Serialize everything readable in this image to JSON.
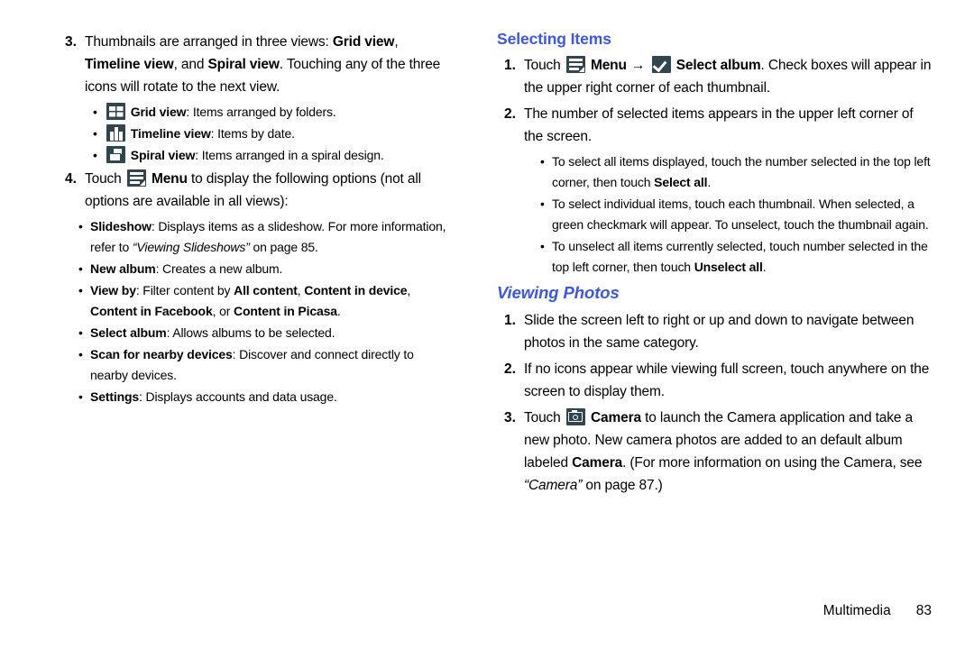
{
  "left_column": {
    "step3": {
      "number": "3.",
      "text_a": "Thumbnails are arranged in three views: ",
      "bold_a": "Grid view",
      "text_b": ", ",
      "bold_b": "Timeline view",
      "text_c": ", and ",
      "bold_c": "Spiral view",
      "text_d": ". Touching any of the three icons will rotate to the next view."
    },
    "view_bullets": [
      {
        "icon": "grid-view-icon",
        "label": "Grid view",
        "desc": ": Items arranged by folders."
      },
      {
        "icon": "timeline-view-icon",
        "label": "Timeline view",
        "desc": ": Items by date."
      },
      {
        "icon": "spiral-view-icon",
        "label": "Spiral view",
        "desc": ": Items arranged in a spiral design."
      }
    ],
    "step4": {
      "number": "4.",
      "text_a": "Touch ",
      "icon": "menu-icon",
      "bold_a": "Menu",
      "text_b": " to display the following options (not all options are available in all views):"
    },
    "menu_options": [
      {
        "label": "Slideshow",
        "desc_a": ": Displays items as a slideshow. For more information, refer to ",
        "italic": "“Viewing Slideshows”",
        "desc_b": " on page 85."
      },
      {
        "label": "New album",
        "desc_a": ": Creates a new album.",
        "italic": "",
        "desc_b": ""
      },
      {
        "label": "View by",
        "desc_a": ": Filter content by ",
        "bold_list": [
          "All content",
          "Content in device",
          "Content in Facebook",
          "Content in Picasa"
        ],
        "sep_1": ", ",
        "sep_2": ", ",
        "sep_3": ", or ",
        "desc_b": "."
      },
      {
        "label": "Select album",
        "desc_a": ": Allows albums to be selected.",
        "italic": "",
        "desc_b": ""
      },
      {
        "label": "Scan for nearby devices",
        "desc_a": ": Discover and connect directly to nearby devices.",
        "italic": "",
        "desc_b": ""
      },
      {
        "label": "Settings",
        "desc_a": ": Displays accounts and data usage.",
        "italic": "",
        "desc_b": ""
      }
    ]
  },
  "right_column": {
    "heading_selecting": "Selecting Items",
    "step1": {
      "number": "1.",
      "text_a": "Touch ",
      "menu_icon": "menu-icon",
      "bold_menu": "Menu",
      "arrow": "→",
      "check_icon": "check-icon",
      "bold_select": "Select album",
      "text_b": ". Check boxes will appear in the upper right corner of each thumbnail."
    },
    "step2": {
      "number": "2.",
      "text": "The number of selected items appears in the upper left corner of the screen."
    },
    "select_bullets": [
      {
        "text_a": "To select all items displayed, touch the number selected in the top left corner, then touch ",
        "bold": "Select all",
        "text_b": "."
      },
      {
        "text_a": "To select individual items, touch each thumbnail. When selected, a green checkmark will appear. To unselect, touch the thumbnail again.",
        "bold": "",
        "text_b": ""
      },
      {
        "text_a": "To unselect all items currently selected, touch number selected in the top left corner, then touch ",
        "bold": "Unselect all",
        "text_b": "."
      }
    ],
    "heading_viewing": "Viewing Photos",
    "view_step1": {
      "number": "1.",
      "text": "Slide the screen left to right or up and down to navigate between photos in the same category."
    },
    "view_step2": {
      "number": "2.",
      "text": "If no icons appear while viewing full screen, touch anywhere on the screen to display them."
    },
    "view_step3": {
      "number": "3.",
      "text_a": "Touch ",
      "icon": "camera-icon",
      "bold_a": "Camera",
      "text_b": " to launch the Camera application and take a new photo. New camera photos are added to an default album labeled ",
      "bold_b": "Camera",
      "text_c": ". (For more information on using the Camera, see ",
      "italic": "“Camera”",
      "text_d": " on page 87.)"
    }
  },
  "footer": {
    "section": "Multimedia",
    "page": "83"
  },
  "colors": {
    "heading_blue": "#3b57e8",
    "icon_slate": "#2f4550",
    "text_black": "#000000"
  }
}
